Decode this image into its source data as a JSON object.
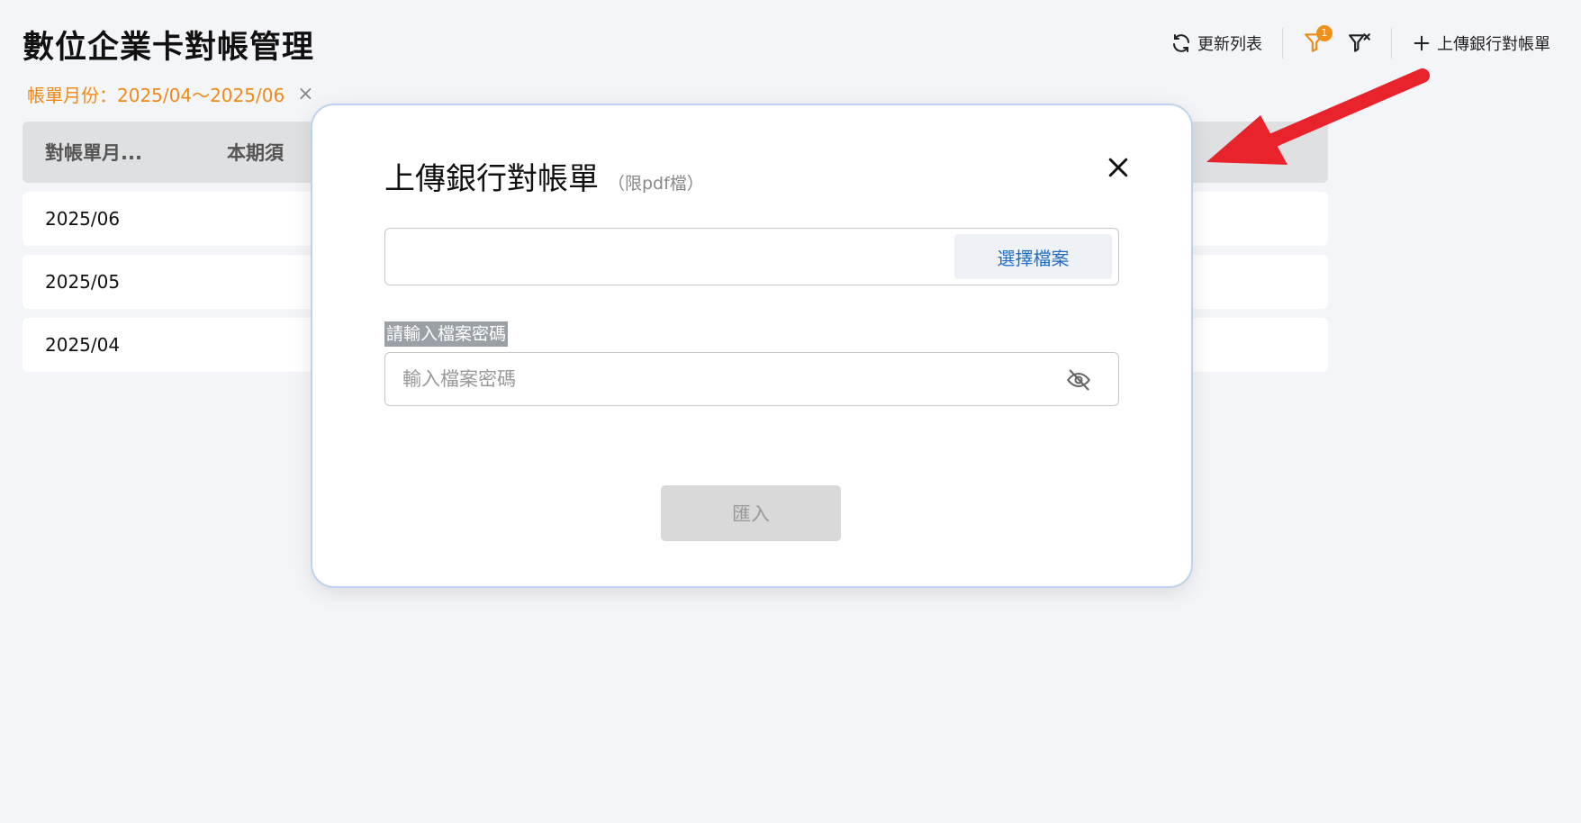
{
  "page": {
    "title": "數位企業卡對帳管理"
  },
  "toolbar": {
    "refresh_label": "更新列表",
    "filter_badge": "1",
    "upload_label": "上傳銀行對帳單"
  },
  "filter": {
    "label": "帳單月份：",
    "value": "2025/04〜2025/06",
    "close": "×"
  },
  "table": {
    "headers": [
      "對帳單月...",
      "本期須"
    ],
    "rows": [
      "2025/06",
      "2025/05",
      "2025/04"
    ]
  },
  "dialog": {
    "title": "上傳銀行對帳單",
    "subtitle": "（限pdf檔）",
    "choose_file_label": "選擇檔案",
    "password_label": "請輸入檔案密碼",
    "password_placeholder": "輸入檔案密碼",
    "import_label": "匯入"
  },
  "colors": {
    "accent_orange": "#ef8a17",
    "link_blue": "#1f6dc4",
    "annotation_red": "#e8232b"
  }
}
